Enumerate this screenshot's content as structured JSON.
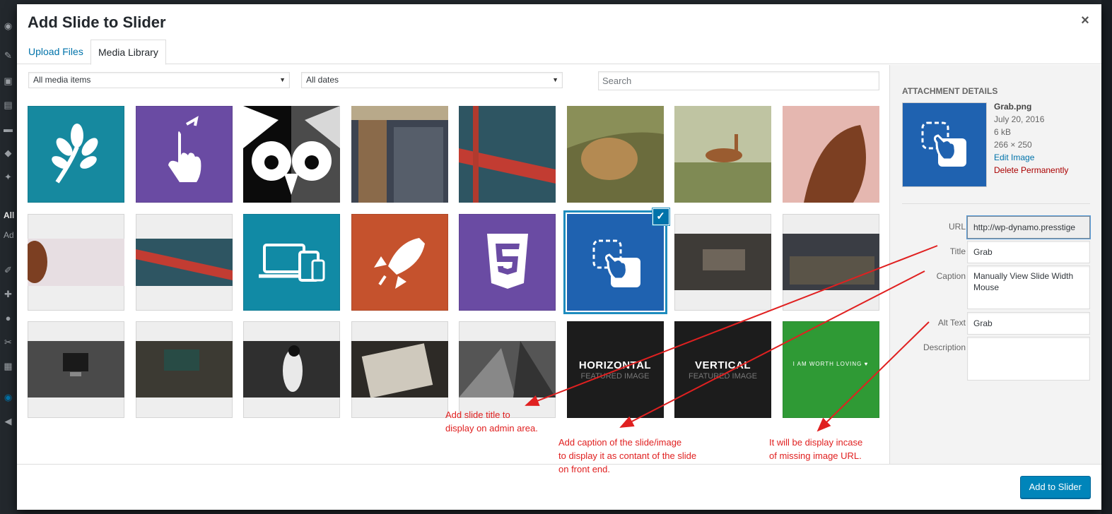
{
  "admin_sidebar": {
    "label_all": "All",
    "label_ad": "Ad"
  },
  "modal": {
    "title": "Add Slide to Slider",
    "close_glyph": "×",
    "tabs": [
      "Upload Files",
      "Media Library"
    ],
    "active_tab": "Media Library"
  },
  "filters": {
    "media_type": "All media items",
    "dates": "All dates",
    "search_placeholder": "Search"
  },
  "tiles": [
    {
      "kind": "leaf-icon",
      "bg": "#16899f"
    },
    {
      "kind": "hand-icon",
      "bg": "#6a4ba3"
    },
    {
      "kind": "owl-graphic",
      "bg": "#e5e5e5"
    },
    {
      "kind": "building-photo",
      "bg": "#8a7d6a"
    },
    {
      "kind": "bridge-photo",
      "bg": "#2f4f5a"
    },
    {
      "kind": "lion-photo",
      "bg": "#8d7a4e"
    },
    {
      "kind": "antelope-photo",
      "bg": "#9aa47a"
    },
    {
      "kind": "horse-photo",
      "bg": "#d9aaa3"
    },
    {
      "kind": "horse-banner",
      "bg": "#eeeeee"
    },
    {
      "kind": "bridge-banner",
      "bg": "#eeeeee"
    },
    {
      "kind": "devices-icon",
      "bg": "#118aa5"
    },
    {
      "kind": "rocket-icon",
      "bg": "#c5522d"
    },
    {
      "kind": "css3-icon",
      "bg": "#6a4ba3"
    },
    {
      "kind": "grab-icon",
      "bg": "#1f62b0",
      "selected": true
    },
    {
      "kind": "laptop-banner",
      "bg": "#eeeeee"
    },
    {
      "kind": "books-banner",
      "bg": "#eeeeee"
    },
    {
      "kind": "desk-banner",
      "bg": "#eeeeee"
    },
    {
      "kind": "typewriter-banner",
      "bg": "#eeeeee"
    },
    {
      "kind": "woman-banner",
      "bg": "#eeeeee"
    },
    {
      "kind": "notebook-banner",
      "bg": "#eeeeee"
    },
    {
      "kind": "buildings-banner",
      "bg": "#eeeeee"
    },
    {
      "kind": "text-card",
      "bg": "#1c1c1c",
      "title": "HORIZONTAL",
      "subtitle": "FEATURED IMAGE"
    },
    {
      "kind": "text-card",
      "bg": "#1c1c1c",
      "title": "VERTICAL",
      "subtitle": "FEATURED IMAGE"
    },
    {
      "kind": "green-card",
      "bg": "#2f9a35",
      "title": "I AM WORTH LOVING"
    }
  ],
  "details": {
    "heading": "ATTACHMENT DETAILS",
    "filename": "Grab.png",
    "date": "July 20, 2016",
    "size": "6 kB",
    "dimensions": "266 × 250",
    "edit_link": "Edit Image",
    "delete_link": "Delete Permanently",
    "fields": {
      "url_label": "URL",
      "url_value": "http://wp-dynamo.presstige",
      "title_label": "Title",
      "title_value": "Grab",
      "caption_label": "Caption",
      "caption_value": "Manually View Slide Width Mouse",
      "alt_label": "Alt Text",
      "alt_value": "Grab",
      "description_label": "Description",
      "description_value": ""
    }
  },
  "footer": {
    "button": "Add to Slider"
  },
  "annotations": {
    "title_note": [
      "Add slide title to",
      "display on admin area."
    ],
    "caption_note": [
      "Add caption of the slide/image",
      "to display it as contant of the slide",
      "on front end."
    ],
    "alt_note": [
      "It will be display incase",
      "of missing image URL."
    ]
  },
  "colors": {
    "accent": "#0073aa",
    "primary_button": "#0085ba",
    "annotation": "#e02020"
  }
}
